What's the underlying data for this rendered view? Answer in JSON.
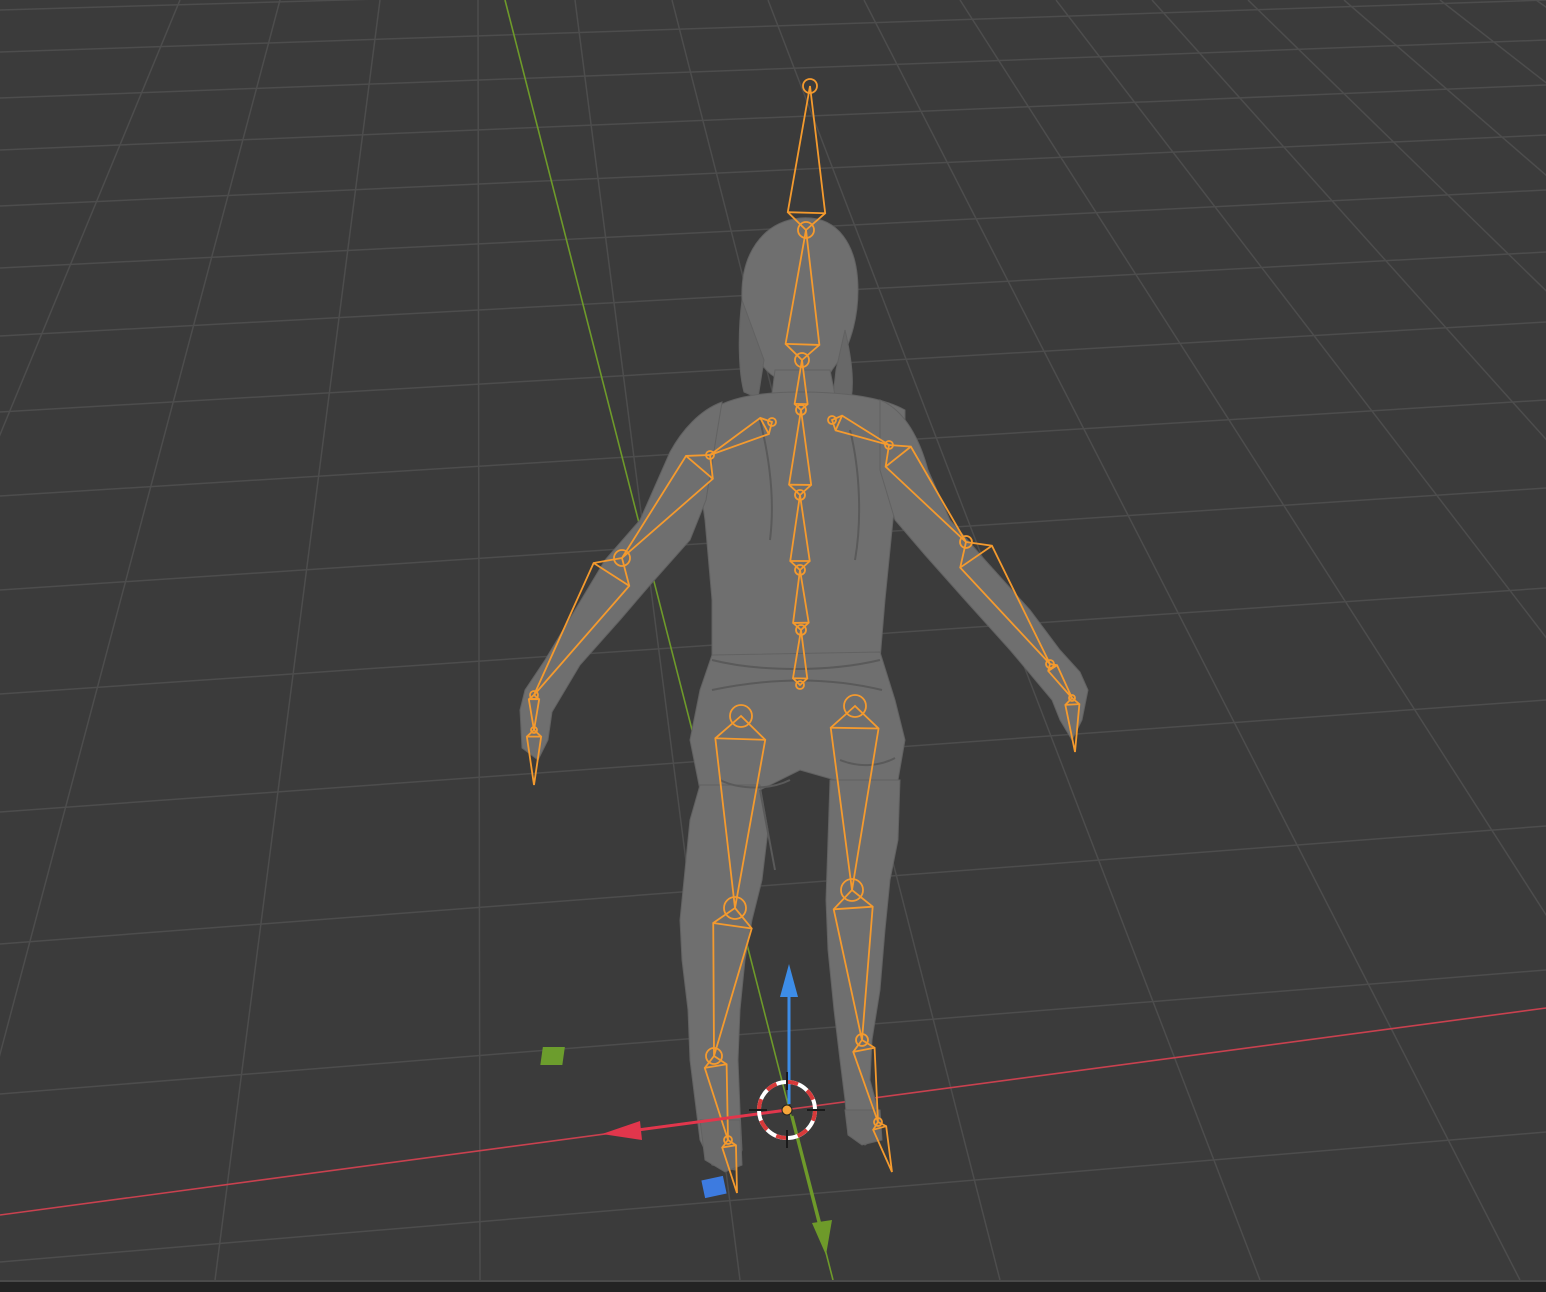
{
  "viewport": {
    "background_color": "#3b3b3b",
    "grid_color": "#4d4d4d",
    "x_axis_color": "#c9414f",
    "y_axis_color": "#6e9a2a",
    "armature_color": "#f49a2e",
    "mesh_color": "#6f6f6f",
    "mesh_shadow_color": "#595959"
  },
  "gizmo": {
    "x_arrow_color": "#e2364c",
    "y_arrow_color": "#6e9a2a",
    "z_arrow_color": "#3d8de8",
    "x_plane_handle_color": "#3d7be0",
    "y_plane_handle_color": "#6c9d2d",
    "cursor_ring_colors": [
      "#ffffff",
      "#d83a3a"
    ],
    "origin_dot_color": "#f7a63a"
  },
  "icons": [
    "armature-bone-icon",
    "3d-cursor-icon",
    "transform-gizmo-icon"
  ]
}
